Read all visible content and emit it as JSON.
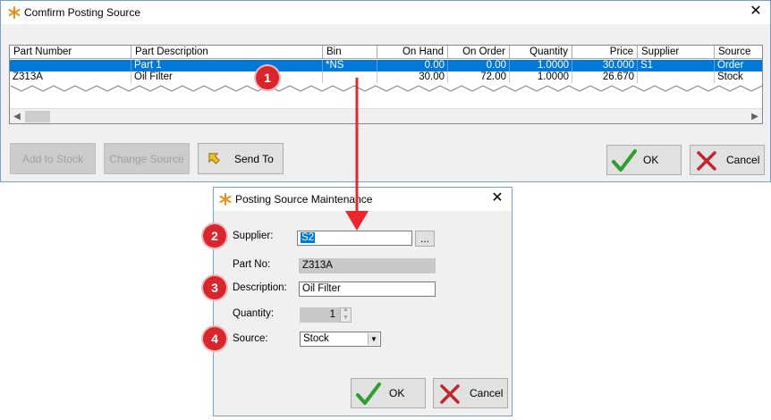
{
  "confirm_window": {
    "title": "Comfirm Posting Source",
    "columns": [
      "Part Number",
      "Part Description",
      "Bin",
      "On Hand",
      "On Order",
      "Quantity",
      "Price",
      "Supplier",
      "Source"
    ],
    "rows": [
      {
        "part_number": "",
        "description": "Part 1",
        "bin": "*NS",
        "on_hand": "0.00",
        "on_order": "0.00",
        "quantity": "1.0000",
        "price": "30.000",
        "supplier": "S1",
        "source": "Order",
        "selected": true
      },
      {
        "part_number": "Z313A",
        "description": "Oil Filter",
        "bin": "",
        "on_hand": "30.00",
        "on_order": "72.00",
        "quantity": "1.0000",
        "price": "26.670",
        "supplier": "",
        "source": "Stock",
        "selected": false
      }
    ],
    "buttons": {
      "add_to_stock": "Add to Stock",
      "change_source": "Change Source",
      "send_to": "Send To",
      "ok": "OK",
      "cancel": "Cancel"
    }
  },
  "maintenance_window": {
    "title": "Posting Source Maintenance",
    "labels": {
      "supplier": "Supplier:",
      "part_no": "Part No:",
      "description": "Description:",
      "quantity": "Quantity:",
      "source": "Source:"
    },
    "values": {
      "supplier": "S2",
      "part_no": "Z313A",
      "description": "Oil Filter",
      "quantity": "1",
      "source": "Stock"
    },
    "browse_label": "...",
    "buttons": {
      "ok": "OK",
      "cancel": "Cancel"
    }
  },
  "callouts": [
    "1",
    "2",
    "3",
    "4"
  ],
  "colors": {
    "accent_red": "#d9262c",
    "selection": "#0078d7",
    "ok_check": "#2e9e2e",
    "cancel_x": "#c0262c"
  }
}
